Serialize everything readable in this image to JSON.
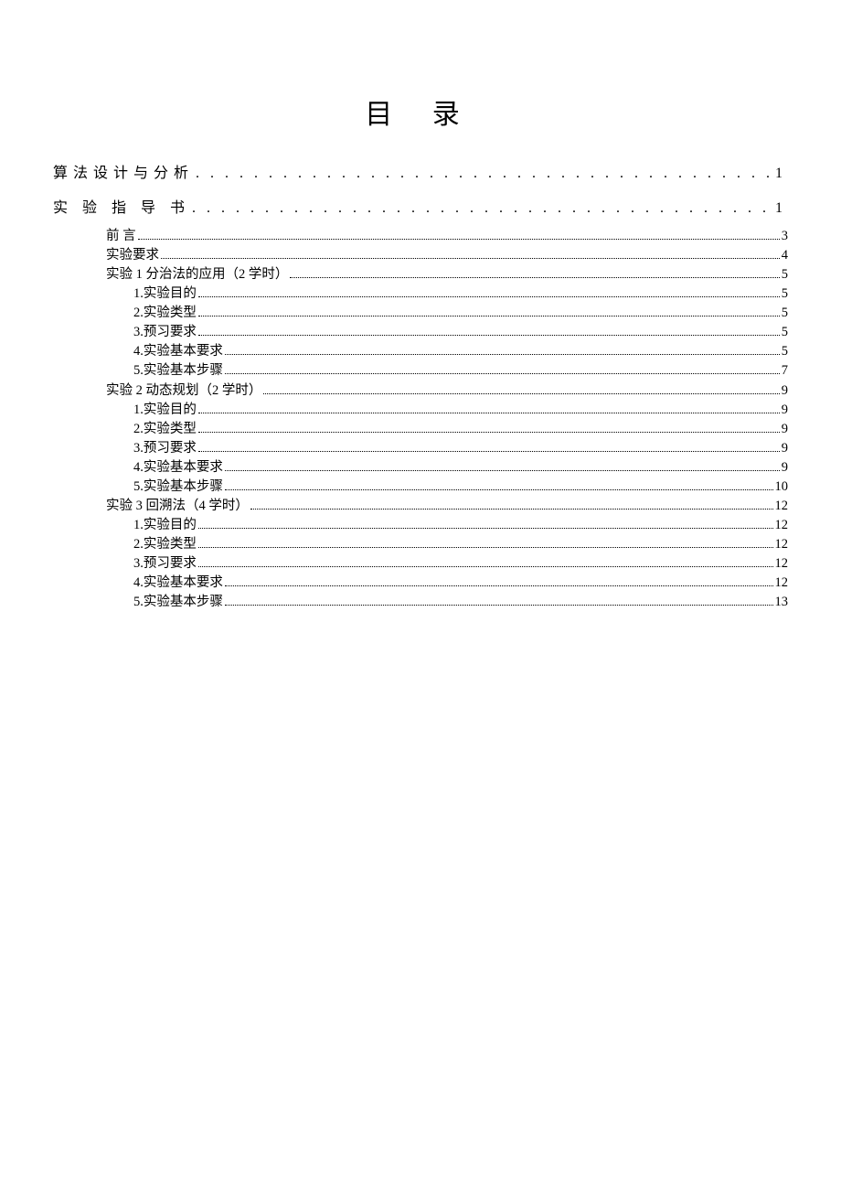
{
  "title": "目 录",
  "entries": [
    {
      "label": "算法设计与分析",
      "page": "1",
      "indent": 0,
      "style": "large"
    },
    {
      "label": "实 验 指 导 书",
      "page": "1",
      "indent": 0,
      "style": "large"
    },
    {
      "label": "前 言",
      "page": "3",
      "indent": 1,
      "style": "normal"
    },
    {
      "label": "实验要求",
      "page": "4",
      "indent": 1,
      "style": "normal"
    },
    {
      "label": "实验 1 分治法的应用（2 学时）",
      "page": "5",
      "indent": 1,
      "style": "normal"
    },
    {
      "label": "1.实验目的",
      "page": "5",
      "indent": 2,
      "style": "normal"
    },
    {
      "label": "2.实验类型",
      "page": "5",
      "indent": 2,
      "style": "normal"
    },
    {
      "label": "3.预习要求",
      "page": "5",
      "indent": 2,
      "style": "normal"
    },
    {
      "label": "4.实验基本要求",
      "page": "5",
      "indent": 2,
      "style": "normal"
    },
    {
      "label": "5.实验基本步骤",
      "page": "7",
      "indent": 2,
      "style": "normal"
    },
    {
      "label": "实验 2 动态规划（2 学时）",
      "page": "9",
      "indent": 1,
      "style": "normal"
    },
    {
      "label": "1.实验目的",
      "page": "9",
      "indent": 2,
      "style": "normal"
    },
    {
      "label": "2.实验类型",
      "page": "9",
      "indent": 2,
      "style": "normal"
    },
    {
      "label": "3.预习要求",
      "page": "9",
      "indent": 2,
      "style": "normal"
    },
    {
      "label": "4.实验基本要求",
      "page": "9",
      "indent": 2,
      "style": "normal"
    },
    {
      "label": "5.实验基本步骤",
      "page": "10",
      "indent": 2,
      "style": "normal"
    },
    {
      "label": "实验 3 回溯法（4 学时）",
      "page": "12",
      "indent": 1,
      "style": "normal"
    },
    {
      "label": "1.实验目的",
      "page": "12",
      "indent": 2,
      "style": "normal"
    },
    {
      "label": "2.实验类型",
      "page": "12",
      "indent": 2,
      "style": "normal"
    },
    {
      "label": "3.预习要求",
      "page": "12",
      "indent": 2,
      "style": "normal"
    },
    {
      "label": "4.实验基本要求",
      "page": "12",
      "indent": 2,
      "style": "normal"
    },
    {
      "label": "5.实验基本步骤",
      "page": "13",
      "indent": 2,
      "style": "normal"
    }
  ]
}
